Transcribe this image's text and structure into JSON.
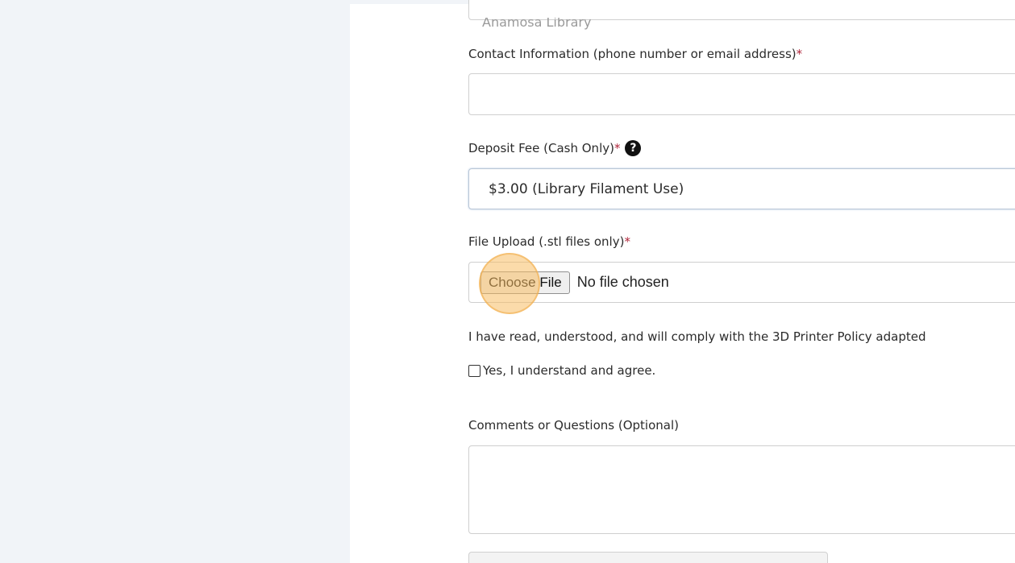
{
  "form": {
    "previous_field_value": "Anamosa Library",
    "contact": {
      "label": "Contact Information (phone number or email address)",
      "required_mark": "*",
      "value": ""
    },
    "deposit": {
      "label": "Deposit Fee (Cash Only)",
      "required_mark": "*",
      "help_glyph": "?",
      "selected": "$3.00 (Library Filament Use)"
    },
    "upload": {
      "label": "File Upload (.stl files only)",
      "required_mark": "*",
      "button_label": "Choose File",
      "status": "No file chosen"
    },
    "policy": {
      "text": "I have read, understood, and will comply with the 3D Printer Policy adapted",
      "checkbox_label": "Yes, I understand and agree.",
      "checked": false
    },
    "comments": {
      "label": "Comments or Questions (Optional)",
      "value": ""
    }
  },
  "colors": {
    "background": "#f1f4f8",
    "panel": "#ffffff",
    "required": "#b0263b",
    "click_marker": "#f7be64"
  },
  "icons": [
    "help-circle-icon",
    "checkbox-icon"
  ]
}
